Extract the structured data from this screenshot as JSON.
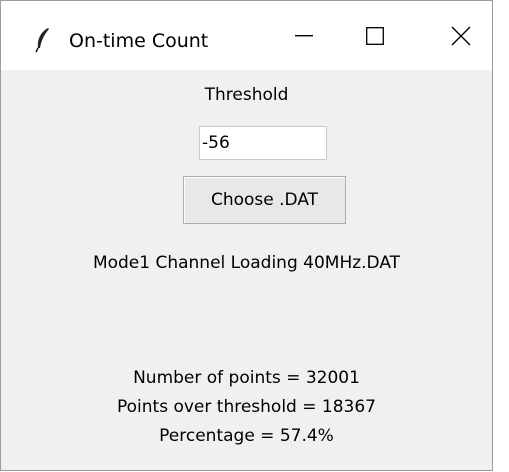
{
  "window": {
    "title": "On-time Count",
    "icon": "feather-icon",
    "controls": [
      "minimize-icon",
      "maximize-icon",
      "close-icon"
    ]
  },
  "form": {
    "threshold_label": "Threshold",
    "threshold_value": "-56",
    "choose_button_label": "Choose .DAT",
    "selected_file": "Mode1 Channel Loading 40MHz.DAT"
  },
  "results": {
    "points": "Number of points = 32001",
    "over_threshold": "Points over threshold = 18367",
    "percentage": "Percentage = 57.4%"
  }
}
